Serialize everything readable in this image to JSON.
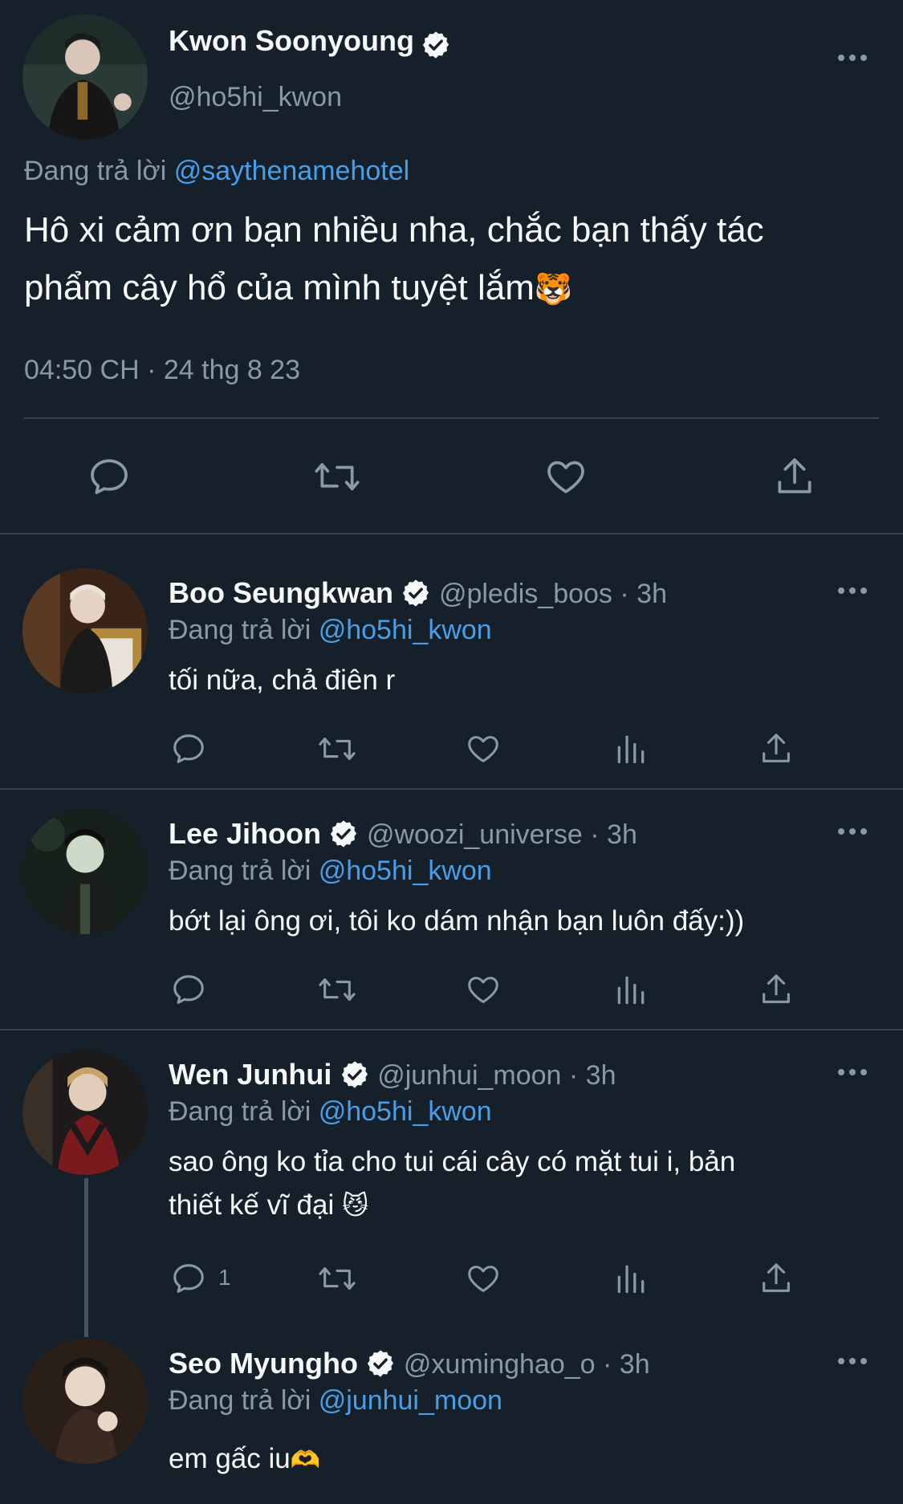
{
  "main_tweet": {
    "author_name": "Kwon Soonyoung",
    "author_handle": "@ho5hi_kwon",
    "reply_prefix": "Đang trả lời",
    "reply_to": "@saythenamehotel",
    "text_line1": "Hô xi cảm ơn bạn nhiều nha, chắc bạn thấy tác",
    "text_line2": "phẩm cây hổ của mình tuyệt lắm",
    "emoji": "🐯",
    "timestamp": "04:50 CH · 24 thg 8 23"
  },
  "replies": [
    {
      "name": "Boo Seungkwan",
      "handle": "@pledis_boos",
      "time": "· 3h",
      "reply_prefix": "Đang trả lời",
      "reply_to": "@ho5hi_kwon",
      "text": "tối nữa, chả điên r"
    },
    {
      "name": "Lee Jihoon",
      "handle": "@woozi_universe",
      "time": "· 3h",
      "reply_prefix": "Đang trả lời",
      "reply_to": "@ho5hi_kwon",
      "text": "bớt lại ông ơi, tôi ko dám nhận bạn luôn đấy:))"
    },
    {
      "name": "Wen Junhui",
      "handle": "@junhui_moon",
      "time": "· 3h",
      "reply_prefix": "Đang trả lời",
      "reply_to": "@ho5hi_kwon",
      "text_line1": "sao ông ko tỉa cho tui cái cây có mặt tui i, bản",
      "text_line2": "thiết kế vĩ đại",
      "emoji": "😼",
      "reply_count": "1"
    },
    {
      "name": "Seo Myungho",
      "handle": "@xuminghao_o",
      "time": "· 3h",
      "reply_prefix": "Đang trả lời",
      "reply_to": "@junhui_moon",
      "text": "em gấc iu",
      "emoji": "🫶"
    }
  ],
  "icons": {
    "reply": "speech-bubble-icon",
    "retweet": "retweet-icon",
    "like": "heart-icon",
    "views": "bar-chart-icon",
    "share": "share-icon",
    "verified": "verified-badge-icon",
    "more": "more-dots-icon"
  },
  "colors": {
    "background": "#15202b",
    "text": "#f7f9f9",
    "muted": "#8b98a5",
    "link": "#4a9ee8",
    "divider": "#38444d"
  }
}
